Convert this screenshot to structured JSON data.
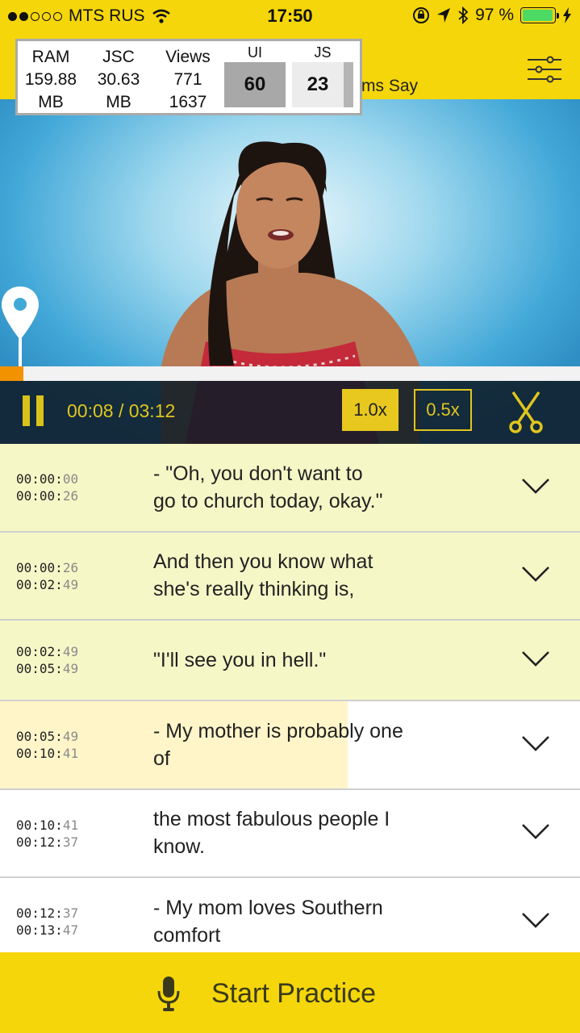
{
  "status_bar": {
    "carrier": "MTS RUS",
    "time": "17:50",
    "battery_percent": "97 %",
    "battery_level": 0.97,
    "signal_bars_filled": 2,
    "signal_bars_total": 5
  },
  "header": {
    "title_partial": "ms Say"
  },
  "perf_monitor": {
    "ram_label": "RAM",
    "ram_value": "159.88",
    "ram_unit": "MB",
    "jsc_label": "JSC",
    "jsc_value": "30.63",
    "jsc_unit": "MB",
    "views_label": "Views",
    "views_value1": "771",
    "views_value2": "1637",
    "ui_label": "UI",
    "ui_value": "60",
    "js_label": "JS",
    "js_value": "23"
  },
  "player": {
    "time_display": "00:08 / 03:12",
    "progress_fraction": 0.04,
    "speed_active": "1.0x",
    "speed_inactive": "0.5x"
  },
  "subtitles": [
    {
      "start_main": "00:00",
      "start_ms": "00",
      "end_main": "00:00",
      "end_ms": "26",
      "line1": "- \"Oh, you don't want to",
      "line2": "go to church today, okay.\"",
      "state": "done"
    },
    {
      "start_main": "00:00",
      "start_ms": "26",
      "end_main": "00:02",
      "end_ms": "49",
      "line1": "And then you know what",
      "line2": "she's really thinking is,",
      "state": "done"
    },
    {
      "start_main": "00:02",
      "start_ms": "49",
      "end_main": "00:05",
      "end_ms": "49",
      "line1": "\"I'll see you in hell.\"",
      "line2": "",
      "state": "done"
    },
    {
      "start_main": "00:05",
      "start_ms": "49",
      "end_main": "00:10",
      "end_ms": "41",
      "line1": "- My mother is probably one",
      "line2": "of",
      "state": "current"
    },
    {
      "start_main": "00:10",
      "start_ms": "41",
      "end_main": "00:12",
      "end_ms": "37",
      "line1": "the most fabulous people I",
      "line2": "know.",
      "state": "upcoming"
    },
    {
      "start_main": "00:12",
      "start_ms": "37",
      "end_main": "00:13",
      "end_ms": "47",
      "line1": "- My mom loves Southern",
      "line2": "comfort",
      "state": "upcoming"
    }
  ],
  "bottom_bar": {
    "button_label": "Start Practice",
    "icon": "microphone-icon"
  },
  "colors": {
    "brand_yellow": "#f5d60a",
    "done_row": "#f6f7c7",
    "current_highlight": "#fff5c9",
    "progress": "#f39200",
    "control_accent": "#e0c51f"
  }
}
